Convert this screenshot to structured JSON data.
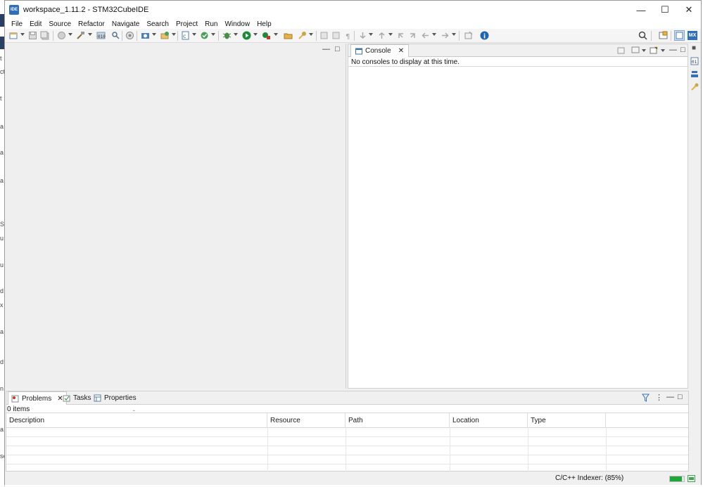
{
  "window": {
    "title": "workspace_1.11.2 - STM32CubeIDE",
    "app_icon_text": "IDE",
    "controls": {
      "minimize": "—",
      "maximize": "☐",
      "close": "✕"
    }
  },
  "background_fragments": [
    "t",
    "ct",
    "t",
    "a",
    "a",
    "a",
    "S",
    "u",
    "u",
    "d",
    "x",
    "a",
    "d",
    "n",
    "a",
    "se"
  ],
  "menu": {
    "items": [
      "File",
      "Edit",
      "Source",
      "Refactor",
      "Navigate",
      "Search",
      "Project",
      "Run",
      "Window",
      "Help"
    ]
  },
  "toolbar": {
    "icons": [
      "new-icon",
      "save-icon",
      "save-all-icon",
      "build-config-icon",
      "build-icon",
      "build-all-icon",
      "debug-search-icon",
      "toggle-icon",
      "new-class-icon",
      "open-type-icon",
      "open-element-icon",
      "refresh-icon",
      "debug-icon",
      "run-icon",
      "external-tools-icon",
      "open-folder-icon",
      "hammer-icon",
      "next-annotation-icon",
      "prev-annotation-icon",
      "pilcrow-icon",
      "back-icon",
      "forward-icon",
      "pin-icon",
      "info-icon",
      "search-icon",
      "open-perspective-icon",
      "cpp-perspective-icon",
      "mx-perspective-icon"
    ],
    "mx_label": "MX"
  },
  "console": {
    "tab_label": "Console",
    "message": "No consoles to display at this time."
  },
  "problems": {
    "tabs": [
      "Problems",
      "Tasks",
      "Properties"
    ],
    "items_count": "0 items",
    "columns": [
      "Description",
      "Resource",
      "Path",
      "Location",
      "Type"
    ]
  },
  "status": {
    "indexer_text": "C/C++ Indexer: (85%)",
    "indexer_progress": 0.85,
    "progress_color": "#1fa63a"
  },
  "colors": {
    "accent": "#2f6fb9",
    "run_green": "#1e8a3a",
    "debug_red": "#c0392b"
  }
}
